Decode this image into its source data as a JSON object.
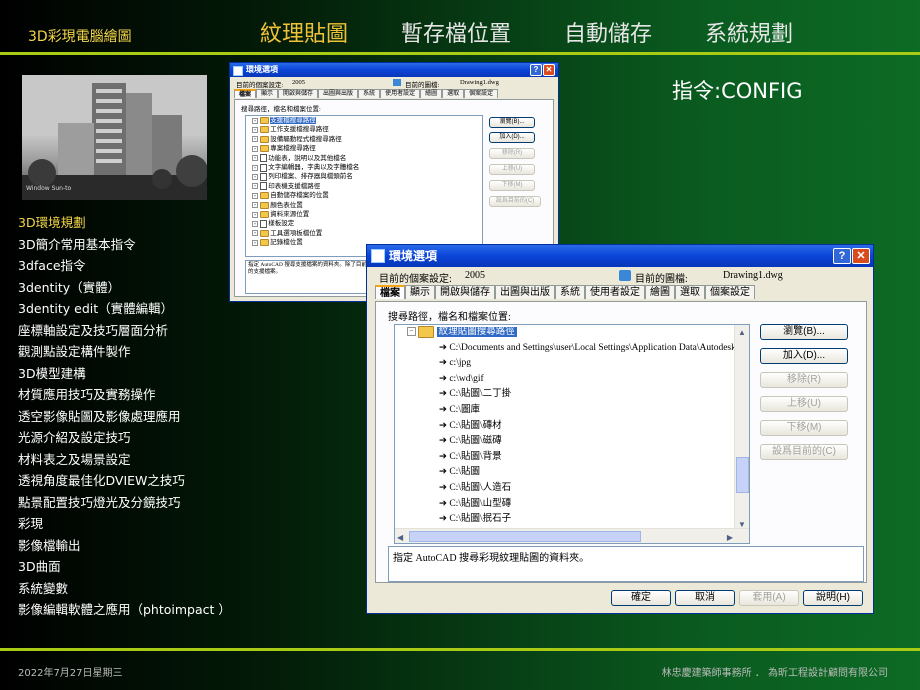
{
  "header": {
    "brand": "3D彩現電腦繪圖",
    "nav": [
      "紋理貼圖",
      "暫存檔位置",
      "自動儲存",
      "系統規劃"
    ],
    "active_nav": 0
  },
  "command_title": "指令:CONFIG",
  "photo_caption": "Window Sun-to",
  "menu": [
    "3D環境規劃",
    "3D簡介常用基本指令",
    "3dface指令",
    "3dentity（實體）",
    "3dentity edit（實體編輯）",
    "座標軸設定及技巧層面分析",
    "觀測點設定構件製作",
    "3D模型建構",
    "材質應用技巧及實務操作",
    "透空影像貼圖及影像處理應用",
    "光源介紹及設定技巧",
    "材料表之及場景設定",
    "透視角度最佳化DVIEW之技巧",
    "點景配置技巧燈光及分鏡技巧",
    "彩現",
    "影像檔輸出",
    "3D曲面",
    "系統變數",
    "影像編輯軟體之應用（phtoimpact ）"
  ],
  "active_menu": 0,
  "footer": {
    "date": "2022年7月27日星期三",
    "company": "林忠慶建築師事務所 ． 為昕工程設計顧問有限公司"
  },
  "dialog_small": {
    "title": "環境選項",
    "profile_label": "目前的個案設定:",
    "profile_value": "2005",
    "drawing_label": "目前的圖檔:",
    "drawing_value": "Drawing1.dwg",
    "tabs": [
      "檔案",
      "顯示",
      "開啟與儲存",
      "出圖與出版",
      "系統",
      "使用者設定",
      "繪圖",
      "選取",
      "個案設定"
    ],
    "section_label": "搜尋路徑，檔名和檔案位置:",
    "tree": [
      "支援檔搜尋路徑",
      "工作支援檔搜尋路徑",
      "設備驅動程式檔搜尋路徑",
      "專案檔搜尋路徑",
      "功能表，說明以及其他檔名",
      "文字編輯器，字典以及字體檔名",
      "列印檔案、排存器與檔頭前名",
      "印表機支援檔路徑",
      "自動儲存檔案的位置",
      "顏色表位置",
      "資料來源位置",
      "樣板設定",
      "工具選項板檔位置",
      "記錄檔位置"
    ],
    "buttons": [
      "瀏覽(B)...",
      "加入(D)...",
      "移除(R)",
      "上移(U)",
      "下移(M)",
      "設爲目前的(C)"
    ],
    "description": "指定 AutoCAD 搜尋支援檔案的資料夾。除了目前資料夾中的支援檔案之外，還會搜尋與目前檔案所在位置相同的資料夾中的支援檔案。"
  },
  "dialog_large": {
    "title": "環境選項",
    "profile_label": "目前的個案設定:",
    "profile_value": "2005",
    "drawing_label": "目前的圖檔:",
    "drawing_value": "Drawing1.dwg",
    "tabs": [
      "檔案",
      "顯示",
      "開啟與儲存",
      "出圖與出版",
      "系統",
      "使用者設定",
      "繪圖",
      "選取",
      "個案設定"
    ],
    "section_label": "搜尋路徑，檔名和檔案位置:",
    "tree_root": "紋理貼圖搜尋路徑",
    "tree": [
      "C:\\Documents and Settings\\user\\Local Settings\\Application Data\\Autodesk\\AutoCAD",
      "c:\\jpg",
      "c:\\wd\\gif",
      "C:\\貼圖\\二丁掛",
      "C:\\圖庫",
      "C:\\貼圖\\磚材",
      "C:\\貼圖\\磁磚",
      "C:\\貼圖\\背景",
      "C:\\貼圖",
      "C:\\貼圖\\人造石",
      "C:\\貼圖\\山型磚",
      "C:\\貼圖\\抿石子"
    ],
    "buttons": [
      "瀏覽(B)...",
      "加入(D)...",
      "移除(R)",
      "上移(U)",
      "下移(M)",
      "設爲目前的(C)"
    ],
    "description": "指定 AutoCAD 搜尋彩現紋理貼圖的資料夾。",
    "footer_buttons": [
      "確定",
      "取消",
      "套用(A)",
      "說明(H)"
    ]
  }
}
